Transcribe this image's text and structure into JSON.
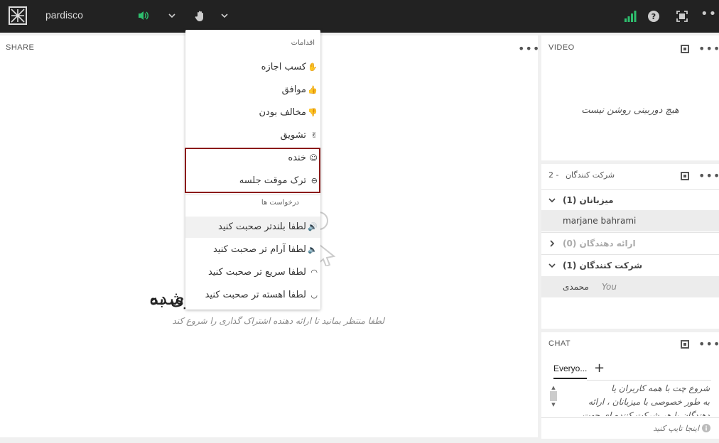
{
  "app": {
    "brand": "pardisco"
  },
  "share": {
    "title": "SHARE",
    "empty_title": "چیزی به",
    "empty_title_tail": "شده",
    "empty_subtitle": "لطفا منتظر بمانید تا ارائه دهنده اشتراک گذاری را شروع کند"
  },
  "video": {
    "title": "VIDEO",
    "no_camera": "هیچ دوربینی روشن نیست"
  },
  "participants": {
    "title": "شرکت کنندگان",
    "count": "2 -",
    "groups": [
      {
        "label": "میزبانان (1)",
        "members": [
          "marjane bahrami"
        ]
      },
      {
        "label": "ارائه دهندگان (0)",
        "members": []
      },
      {
        "label": "شرکت کنندگان (1)",
        "members": [
          {
            "name": "محمدی",
            "tag": "You"
          }
        ]
      }
    ]
  },
  "chat": {
    "title": "CHAT",
    "tab": "Everyo...",
    "add": "+",
    "intro_lines": [
      "شروع چت با همه کاربران یا",
      "به طور خصوصی با میزبانان ، ارائه",
      "دهندگان یا هر شرکت کننده ای جهت"
    ],
    "input_placeholder": "اینجا تایپ کنید"
  },
  "menu": {
    "actions_header": "اقدامات",
    "actions": [
      {
        "label": "کسب اجازه",
        "icon": "hand-icon"
      },
      {
        "label": "موافق",
        "icon": "thumbs-up-icon"
      },
      {
        "label": "مخالف بودن",
        "icon": "thumbs-down-icon"
      },
      {
        "label": "تشویق",
        "icon": "clap-icon"
      },
      {
        "label": "خنده",
        "icon": "laugh-icon"
      },
      {
        "label": "ترک موقت جلسه",
        "icon": "away-icon"
      }
    ],
    "requests_header": "درخواست ها",
    "requests": [
      {
        "label": "لطفا بلندتر صحبت کنید",
        "icon": "volume-up-icon"
      },
      {
        "label": "لطفا آرام تر صحبت کنید",
        "icon": "volume-down-icon"
      },
      {
        "label": "لطفا سریع تر صحبت کنید",
        "icon": "speed-up-icon"
      },
      {
        "label": "لطفا اهسته تر صحبت کنید",
        "icon": "speed-down-icon"
      }
    ]
  },
  "colors": {
    "topbar": "#222222",
    "accent_green": "#2ebf6e",
    "highlight_border": "#8b1a1a"
  }
}
